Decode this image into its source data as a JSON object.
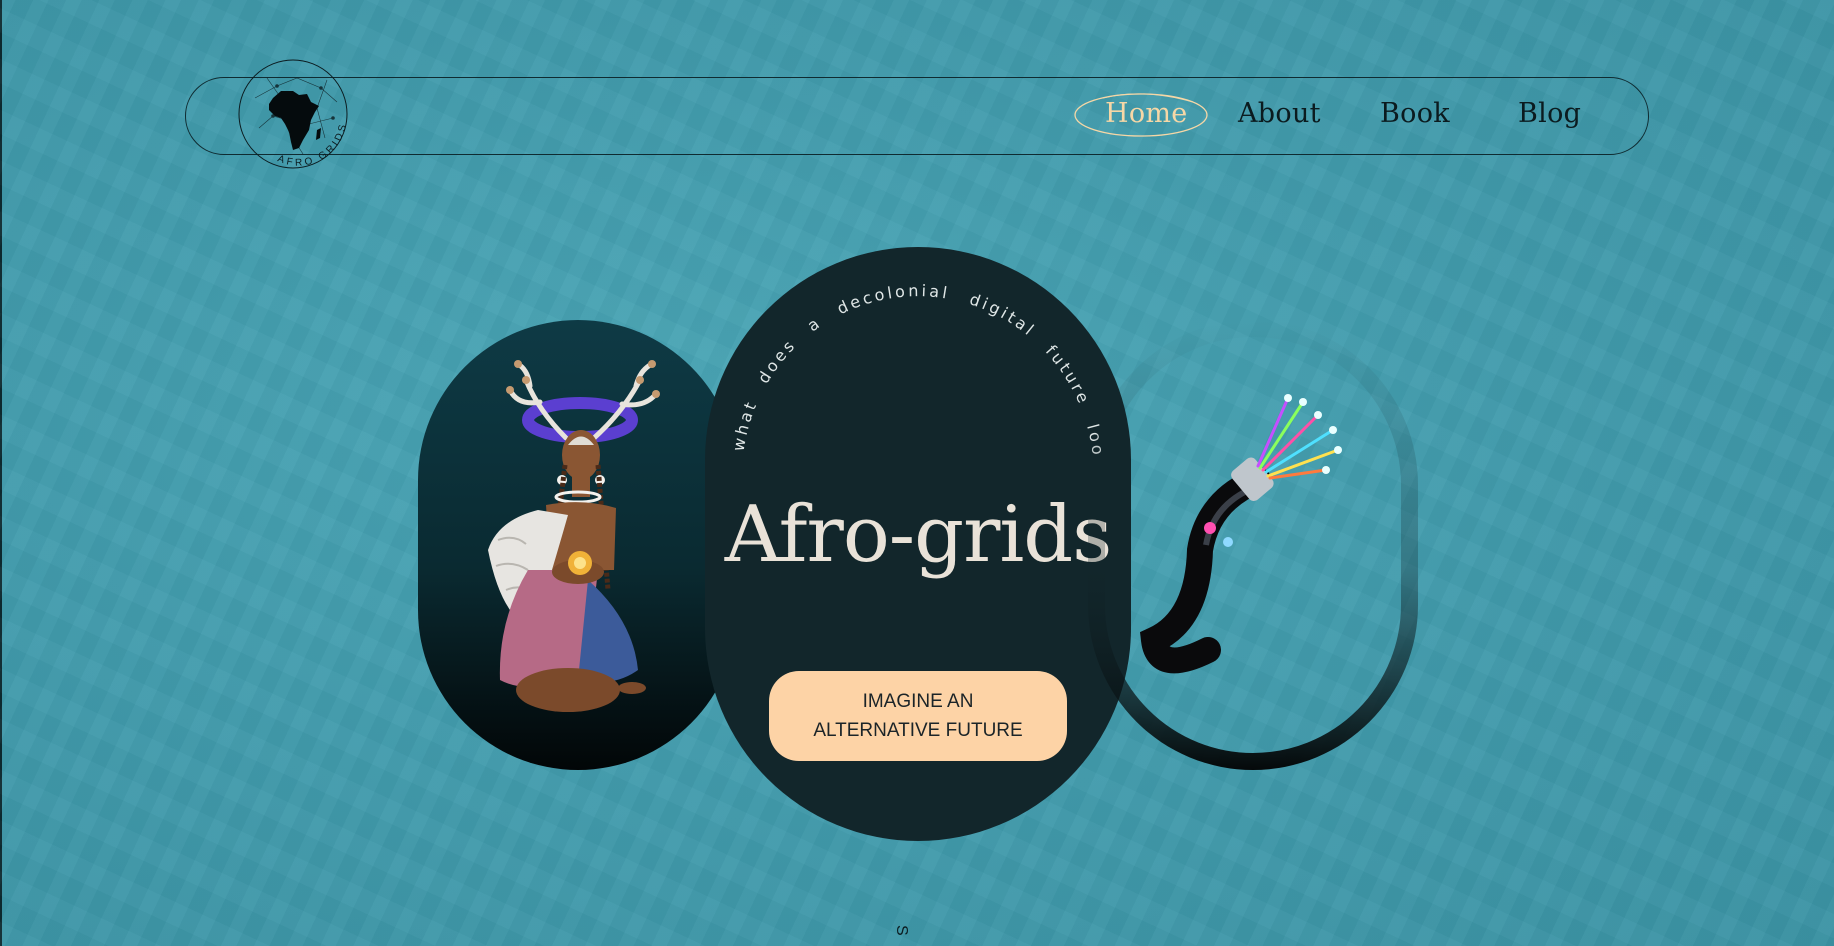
{
  "brand": {
    "logo_text": "AFRO GRIDS"
  },
  "nav": {
    "items": [
      {
        "label": "Home",
        "active": true
      },
      {
        "label": "About"
      },
      {
        "label": "Book"
      },
      {
        "label": "Blog"
      }
    ]
  },
  "hero": {
    "curved_text": "what does a decolonial digital future look like?",
    "title": "Afro-grids",
    "cta_line1": "IMAGINE AN",
    "cta_line2": "ALTERNATIVE FUTURE",
    "scroll_hint": "S"
  },
  "colors": {
    "background": "#429cad",
    "card_dark": "#12262b",
    "cta": "#fdd3a6",
    "nav_active": "#f6d7a6"
  },
  "icons": [
    "africa-map-icon",
    "fiber-optic-cable-illustration",
    "antlered-woman-illustration"
  ]
}
